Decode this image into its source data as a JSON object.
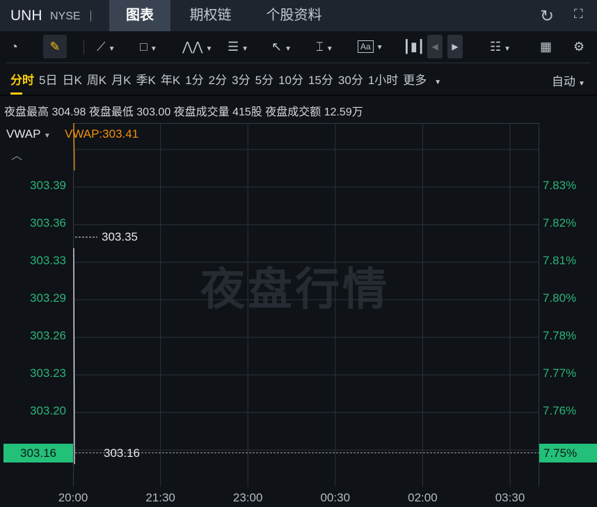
{
  "header": {
    "symbol": "UNH",
    "exchange": "NYSE",
    "tabs": [
      "图表",
      "期权链",
      "个股资料"
    ],
    "active_tab": 0
  },
  "toolbar": {
    "tools": [
      "gauge-icon",
      "pencil-icon",
      "line-icon",
      "rectangle-icon",
      "pattern-icon",
      "fib-icon",
      "arrow-icon",
      "measure-icon",
      "text-icon",
      "candle-icon",
      "prev-icon",
      "next-icon",
      "layout-list-icon",
      "grid-icon",
      "settings-icon"
    ]
  },
  "periods": {
    "items": [
      "分时",
      "5日",
      "日K",
      "周K",
      "月K",
      "季K",
      "年K",
      "1分",
      "2分",
      "3分",
      "5分",
      "10分",
      "15分",
      "30分",
      "1小时",
      "更多"
    ],
    "active": 0,
    "scale": "自动"
  },
  "stats": {
    "text": "夜盘最高 304.98 夜盘最低 303.00 夜盘成交量 415股 夜盘成交额 12.59万"
  },
  "indicator": {
    "name": "VWAP",
    "value": "VWAP:303.41",
    "color": "#f0900c"
  },
  "chart_data": {
    "type": "line",
    "watermark": "夜盘行情",
    "y_left_ticks": [
      "303.39",
      "303.36",
      "303.33",
      "303.29",
      "303.26",
      "303.23",
      "303.20"
    ],
    "y_right_ticks": [
      "7.83%",
      "7.82%",
      "7.81%",
      "7.80%",
      "7.78%",
      "7.77%",
      "7.76%"
    ],
    "x_ticks": [
      "20:00",
      "21:30",
      "23:00",
      "00:30",
      "02:00",
      "03:30"
    ],
    "high_label": "303.35",
    "low_label": "303.16",
    "current_price": "303.16",
    "current_pct": "7.75%",
    "series": [
      {
        "name": "price",
        "color": "#e8e8e8",
        "points": [
          [
            "20:00",
            303.35
          ],
          [
            "20:00",
            303.16
          ]
        ]
      },
      {
        "name": "VWAP",
        "color": "#f0900c",
        "points": [
          [
            "20:00",
            303.46
          ],
          [
            "20:00",
            303.41
          ]
        ]
      }
    ],
    "ylim": [
      303.14,
      303.46
    ]
  }
}
